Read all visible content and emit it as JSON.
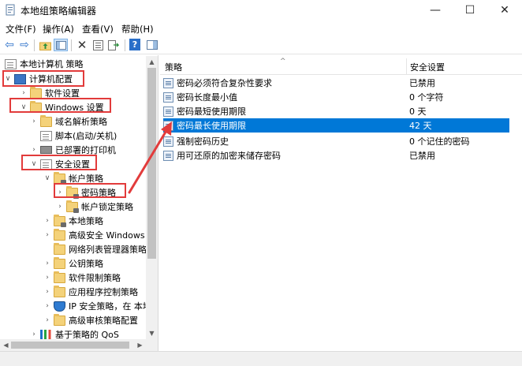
{
  "window": {
    "title": "本地组策略编辑器",
    "minimize_glyph": "—",
    "maximize_glyph": "☐",
    "close_glyph": "✕"
  },
  "menu": [
    "文件(F)",
    "操作(A)",
    "查看(V)",
    "帮助(H)"
  ],
  "toolbar": {
    "back": "⇦",
    "forward": "⇨",
    "delete": "✕",
    "help": "?"
  },
  "tree": {
    "root": "本地计算机 策略",
    "computer_config": "计算机配置",
    "software_settings": "软件设置",
    "windows_settings": "Windows 设置",
    "dns_policy": "域名解析策略",
    "scripts": "脚本(启动/关机)",
    "printers": "已部署的打印机",
    "security_settings": "安全设置",
    "account_policies": "帐户策略",
    "password_policy": "密码策略",
    "lockout_policy": "帐户锁定策略",
    "local_policies": "本地策略",
    "advanced_firewall": "高级安全 Windows",
    "network_list": "网络列表管理器策略",
    "public_key": "公钥策略",
    "software_restriction": "软件限制策略",
    "app_control": "应用程序控制策略",
    "ip_security": "IP 安全策略，在 本地",
    "audit_config": "高级审核策略配置",
    "qos": "基于策略的 QoS"
  },
  "columns": {
    "policy": "策略",
    "setting": "安全设置",
    "sort_glyph": "^"
  },
  "policies": [
    {
      "name": "密码必须符合复杂性要求",
      "value": "已禁用"
    },
    {
      "name": "密码长度最小值",
      "value": "0 个字符"
    },
    {
      "name": "密码最短使用期限",
      "value": "0 天"
    },
    {
      "name": "密码最长使用期限",
      "value": "42 天"
    },
    {
      "name": "强制密码历史",
      "value": "0 个记住的密码"
    },
    {
      "name": "用可还原的加密来储存密码",
      "value": "已禁用"
    }
  ],
  "colors": {
    "selection": "#0078d7",
    "highlight_box": "#e23b3b"
  }
}
